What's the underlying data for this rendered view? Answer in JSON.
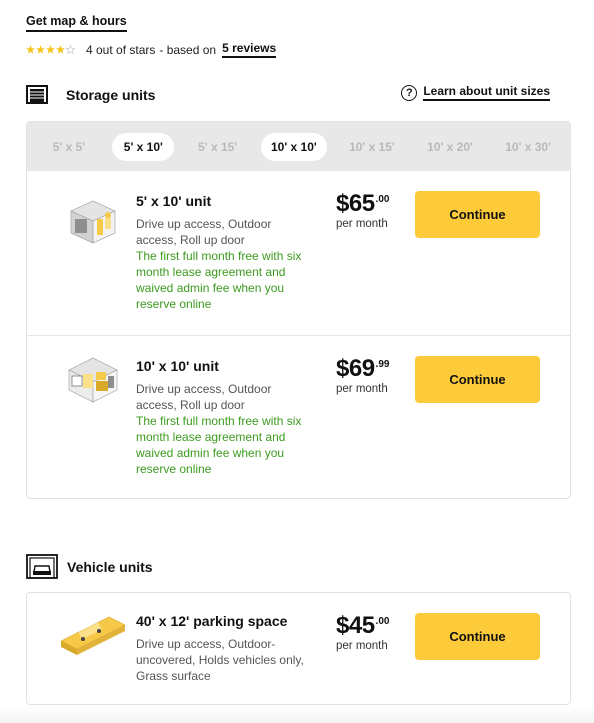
{
  "header": {
    "map_link": "Get map & hours",
    "rating_text": "4 out of stars",
    "based_on": "- based on",
    "reviews_link": "5 reviews",
    "stars_filled": 4,
    "stars_total": 5
  },
  "storage": {
    "title": "Storage units",
    "icon": "storage-unit-icon",
    "learn_link": "Learn about unit sizes",
    "tabs": [
      {
        "label": "5' x 5'",
        "active": false
      },
      {
        "label": "5' x 10'",
        "active": true
      },
      {
        "label": "5' x 15'",
        "active": false
      },
      {
        "label": "10' x 10'",
        "active": true
      },
      {
        "label": "10' x 15'",
        "active": false
      },
      {
        "label": "10' x 20'",
        "active": false
      },
      {
        "label": "10' x 30'",
        "active": false
      }
    ],
    "units": [
      {
        "name": "5' x 10' unit",
        "features": "Drive up access, Outdoor access, Roll up door",
        "promo": "The first full month free with six month lease agreement and waived admin fee when you reserve online",
        "price": "$65",
        "cents": ".00",
        "per": "per month",
        "cta": "Continue"
      },
      {
        "name": "10' x 10' unit",
        "features": "Drive up access, Outdoor access, Roll up door",
        "promo": "The first full month free with six month lease agreement and waived admin fee when you reserve online",
        "price": "$69",
        "cents": ".99",
        "per": "per month",
        "cta": "Continue"
      }
    ]
  },
  "vehicle": {
    "title": "Vehicle units",
    "icon": "vehicle-unit-icon",
    "units": [
      {
        "name": "40' x 12' parking space",
        "features": "Drive up access, Outdoor-uncovered, Holds vehicles only, Grass surface",
        "price": "$45",
        "cents": ".00",
        "per": "per month",
        "cta": "Continue"
      }
    ]
  },
  "colors": {
    "accent_yellow": "#fdcb3a",
    "promo_green": "#3c9b1f",
    "star_yellow": "#f5c518"
  }
}
